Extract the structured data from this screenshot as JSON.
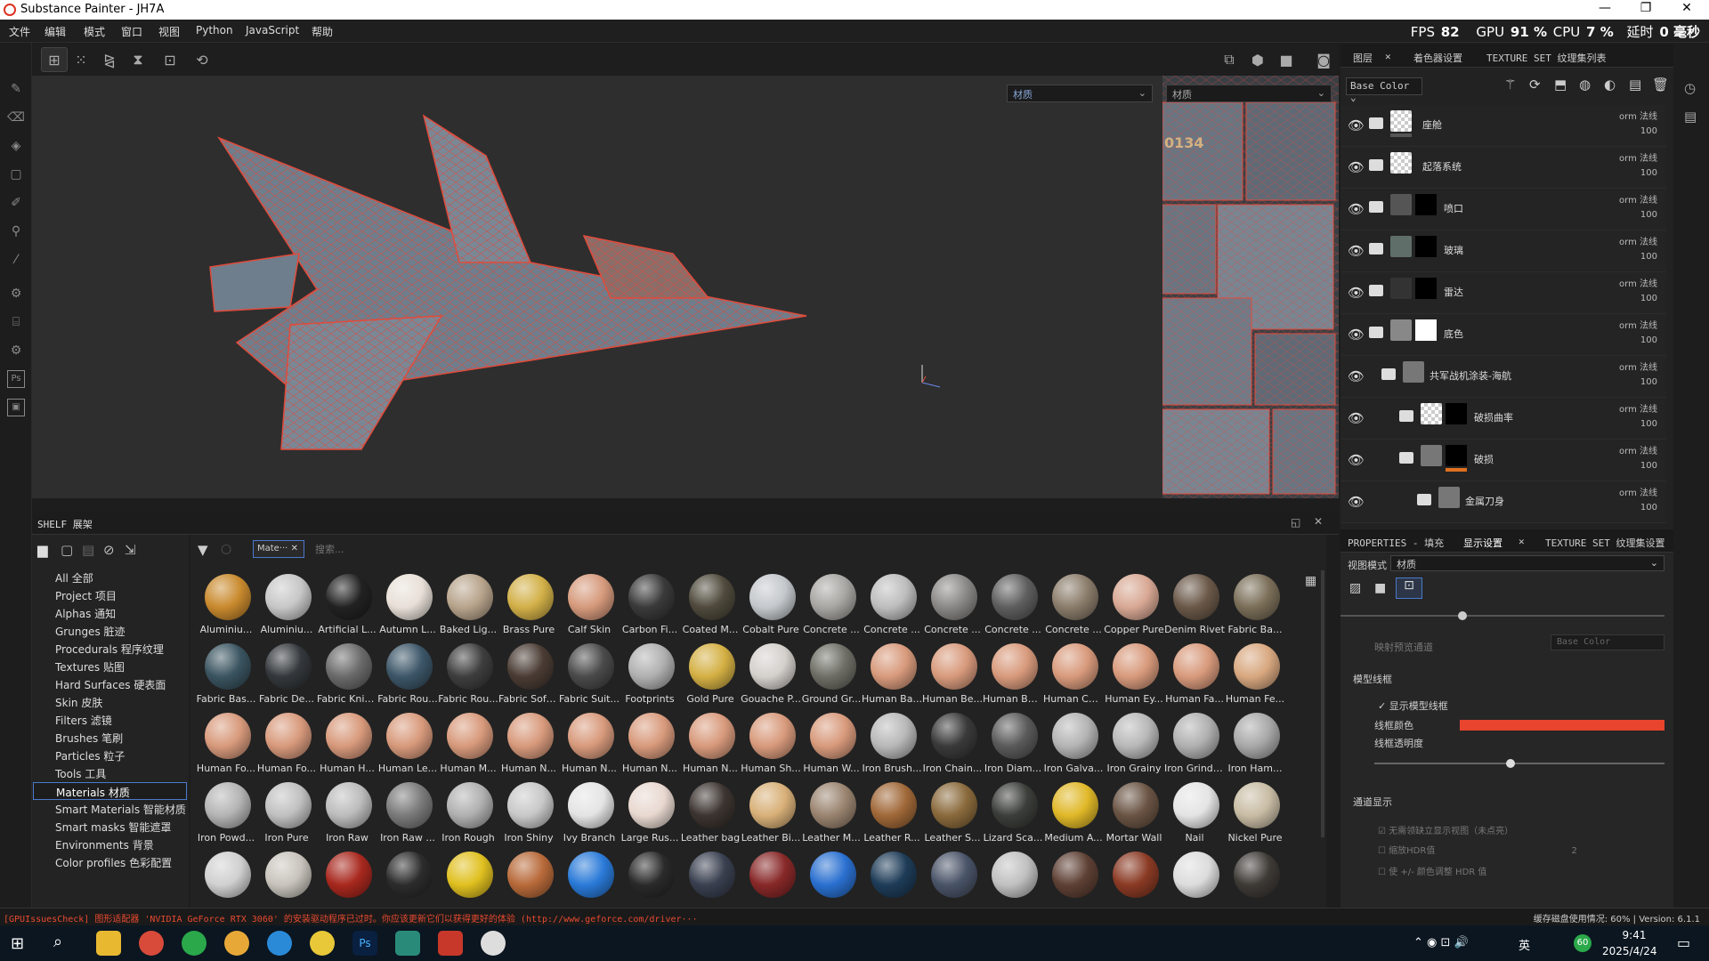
{
  "titlebar": {
    "title": "Substance Painter - JH7A"
  },
  "menu": [
    "文件",
    "编辑",
    "模式",
    "窗口",
    "视图",
    "Python",
    "JavaScript",
    "帮助"
  ],
  "stats": {
    "fps_label": "FPS",
    "fps": "82",
    "gpu_label": "GPU",
    "gpu": "91 %",
    "cpu_label": "CPU",
    "cpu": "7 %",
    "latency_label": "延时",
    "latency": "0 毫秒"
  },
  "viewport": {
    "material_select": "材质",
    "uv_select": "材质",
    "uv_text": "0134"
  },
  "right_tabs": {
    "layers": "图层",
    "texset_settings": "着色器设置",
    "texset_list": "TEXTURE SET 纹理集列表"
  },
  "channel_select": "Base Color",
  "layers": [
    {
      "name": "座舱",
      "blend": "orm 法线",
      "opacity": "100"
    },
    {
      "name": "起落系统",
      "blend": "orm 法线",
      "opacity": "100"
    },
    {
      "name": "喷口",
      "blend": "orm 法线",
      "opacity": "100"
    },
    {
      "name": "玻璃",
      "blend": "orm 法线",
      "opacity": "100"
    },
    {
      "name": "雷达",
      "blend": "orm 法线",
      "opacity": "100"
    },
    {
      "name": "底色",
      "blend": "orm 法线",
      "opacity": "100"
    },
    {
      "name": "共军战机涂装-海航",
      "blend": "orm 法线",
      "opacity": "100"
    },
    {
      "name": "破损曲率",
      "blend": "orm 法线",
      "opacity": "100"
    },
    {
      "name": "破损",
      "blend": "orm 法线",
      "opacity": "100"
    },
    {
      "name": "金属刀身",
      "blend": "orm 法线",
      "opacity": "100"
    }
  ],
  "props_tabs": {
    "properties": "PROPERTIES - 填充",
    "display": "显示设置",
    "texset": "TEXTURE SET 纹理集设置"
  },
  "props": {
    "view_mode_label": "视图模式",
    "view_mode": "材质",
    "map_channel_label": "映射预览通道",
    "map_channel": "Base Color",
    "wire_section": "模型线框",
    "show_wire": "显示模型线框",
    "wire_color": "线框颜色",
    "wire_opacity": "线框透明度",
    "channel_section": "通道显示",
    "ch1": "无需领缺立显示视图（未点亮）",
    "ch2": "缩放HDR值",
    "ch2_val": "2",
    "ch3": "使 +/- 颜色调整 HDR 值",
    "wire_color_hex": "#e8442e"
  },
  "shelf": {
    "title": "SHELF 展架",
    "filter_chip": "Mate···",
    "search_placeholder": "搜索...",
    "categories": [
      "All 全部",
      "Project 项目",
      "Alphas 通知",
      "Grunges 脏迹",
      "Procedurals 程序纹理",
      "Textures 贴图",
      "Hard Surfaces 硬表面",
      "Skin 皮肤",
      "Filters 滤镜",
      "Brushes 笔刷",
      "Particles 粒子",
      "Tools 工具",
      "Materials 材质",
      "Smart Materials 智能材质",
      "Smart masks 智能遮罩",
      "Environments 背景",
      "Color profiles 色彩配置"
    ],
    "selected_category": "Materials 材质",
    "materials": [
      {
        "name": "Aluminiu...",
        "color": "#c98a2e"
      },
      {
        "name": "Aluminiu...",
        "color": "#c7c7c7"
      },
      {
        "name": "Artificial L...",
        "color": "#222222"
      },
      {
        "name": "Autumn L...",
        "color": "#e8e0d8"
      },
      {
        "name": "Baked Lig...",
        "color": "#b8a48c"
      },
      {
        "name": "Brass Pure",
        "color": "#d2b048"
      },
      {
        "name": "Calf Skin",
        "color": "#d69a7c"
      },
      {
        "name": "Carbon Fi...",
        "color": "#3a3a3a"
      },
      {
        "name": "Coated M...",
        "color": "#4f4a3c"
      },
      {
        "name": "Cobalt Pure",
        "color": "#c4c8cc"
      },
      {
        "name": "Concrete ...",
        "color": "#a8a6a2"
      },
      {
        "name": "Concrete ...",
        "color": "#bdbdbd"
      },
      {
        "name": "Concrete ...",
        "color": "#8a8886"
      },
      {
        "name": "Concrete ...",
        "color": "#5e5e5e"
      },
      {
        "name": "Concrete ...",
        "color": "#8a7c6a"
      },
      {
        "name": "Copper Pure",
        "color": "#d8a894"
      },
      {
        "name": "Denim Rivet",
        "color": "#6a5848"
      },
      {
        "name": "Fabric Ba...",
        "color": "#7a6e58"
      },
      {
        "name": "Fabric Bas...",
        "color": "#3a5460"
      },
      {
        "name": "Fabric De...",
        "color": "#34383c"
      },
      {
        "name": "Fabric Knit...",
        "color": "#6a6a6a"
      },
      {
        "name": "Fabric Rou...",
        "color": "#3c5668"
      },
      {
        "name": "Fabric Rou...",
        "color": "#3e3e3e"
      },
      {
        "name": "Fabric Soft...",
        "color": "#4a3c34"
      },
      {
        "name": "Fabric Suit...",
        "color": "#4a4a4a"
      },
      {
        "name": "Footprints",
        "color": "#b0b0b0"
      },
      {
        "name": "Gold Pure",
        "color": "#d4b044"
      },
      {
        "name": "Gouache P...",
        "color": "#d4d0cc"
      },
      {
        "name": "Ground Gr...",
        "color": "#6e6e66"
      },
      {
        "name": "Human Ba...",
        "color": "#d89a7c"
      },
      {
        "name": "Human Be...",
        "color": "#d89a7c"
      },
      {
        "name": "Human Bu...",
        "color": "#d89a7c"
      },
      {
        "name": "Human Ch...",
        "color": "#d89a7c"
      },
      {
        "name": "Human Ey...",
        "color": "#d89a7c"
      },
      {
        "name": "Human Fa...",
        "color": "#d89a7c"
      },
      {
        "name": "Human Fe...",
        "color": "#d8a880"
      },
      {
        "name": "Human Fo...",
        "color": "#d89a7c"
      },
      {
        "name": "Human Fo...",
        "color": "#d89a7c"
      },
      {
        "name": "Human H...",
        "color": "#d89a7c"
      },
      {
        "name": "Human Le...",
        "color": "#d89a7c"
      },
      {
        "name": "Human M...",
        "color": "#d89a7c"
      },
      {
        "name": "Human N...",
        "color": "#d89a7c"
      },
      {
        "name": "Human N...",
        "color": "#d89a7c"
      },
      {
        "name": "Human N...",
        "color": "#d89a7c"
      },
      {
        "name": "Human N...",
        "color": "#d89a7c"
      },
      {
        "name": "Human Sh...",
        "color": "#d89a7c"
      },
      {
        "name": "Human W...",
        "color": "#d89a7c"
      },
      {
        "name": "Iron Brush...",
        "color": "#b8b8b8"
      },
      {
        "name": "Iron Chain...",
        "color": "#3a3a3a"
      },
      {
        "name": "Iron Diam...",
        "color": "#5a5a5a"
      },
      {
        "name": "Iron Galva...",
        "color": "#b4b4b4"
      },
      {
        "name": "Iron Grainy",
        "color": "#b8b8b8"
      },
      {
        "name": "Iron Grinded",
        "color": "#b0b0b0"
      },
      {
        "name": "Iron Ham...",
        "color": "#a8a8a8"
      },
      {
        "name": "Iron Powd...",
        "color": "#b4b4b4"
      },
      {
        "name": "Iron Pure",
        "color": "#c0c0c0"
      },
      {
        "name": "Iron Raw",
        "color": "#bcbcbc"
      },
      {
        "name": "Iron Raw ...",
        "color": "#7a7a7a"
      },
      {
        "name": "Iron Rough",
        "color": "#b0b0b0"
      },
      {
        "name": "Iron Shiny",
        "color": "#c8c8c8"
      },
      {
        "name": "Ivy Branch",
        "color": "#e4e4e4"
      },
      {
        "name": "Large Rus...",
        "color": "#e8d8d0"
      },
      {
        "name": "Leather bag",
        "color": "#3c3430"
      },
      {
        "name": "Leather Bi...",
        "color": "#d8b078"
      },
      {
        "name": "Leather M...",
        "color": "#9a8470"
      },
      {
        "name": "Leather R...",
        "color": "#a06838"
      },
      {
        "name": "Leather S...",
        "color": "#8a6a3c"
      },
      {
        "name": "Lizard Sca...",
        "color": "#3c3e3a"
      },
      {
        "name": "Medium A...",
        "color": "#e0b828"
      },
      {
        "name": "Mortar Wall",
        "color": "#6a5444"
      },
      {
        "name": "Nail",
        "color": "#e4e4e4"
      },
      {
        "name": "Nickel Pure",
        "color": "#c8bca4"
      },
      {
        "name": "",
        "color": "#d0d0d0"
      },
      {
        "name": "",
        "color": "#c8c4bc"
      },
      {
        "name": "",
        "color": "#a8281e"
      },
      {
        "name": "",
        "color": "#2c2c2c"
      },
      {
        "name": "",
        "color": "#e0c020"
      },
      {
        "name": "",
        "color": "#b86a3a"
      },
      {
        "name": "",
        "color": "#2a7ad8"
      },
      {
        "name": "",
        "color": "#2a2a2a"
      },
      {
        "name": "",
        "color": "#3a4050"
      },
      {
        "name": "",
        "color": "#882828"
      },
      {
        "name": "",
        "color": "#2a70d0"
      },
      {
        "name": "",
        "color": "#1e3c58"
      },
      {
        "name": "",
        "color": "#4a5468"
      },
      {
        "name": "",
        "color": "#c0c0c0"
      },
      {
        "name": "",
        "color": "#5e4034"
      },
      {
        "name": "",
        "color": "#8a3a24"
      },
      {
        "name": "",
        "color": "#dcdcdc"
      },
      {
        "name": "",
        "color": "#3e3a36"
      }
    ]
  },
  "statusbar": {
    "left": "[GPUIssuesCheck] 图形适配器 'NVIDIA GeForce RTX 3060' 的安装驱动程序已过时。你应该更新它们以获得更好的体验 (http://www.geforce.com/driver···",
    "right": "缓存磁盘使用情况: 60% | Version: 6.1.1"
  },
  "taskbar": {
    "time": "9:41",
    "date": "2025/4/24",
    "ime": "英",
    "badge": "60"
  }
}
